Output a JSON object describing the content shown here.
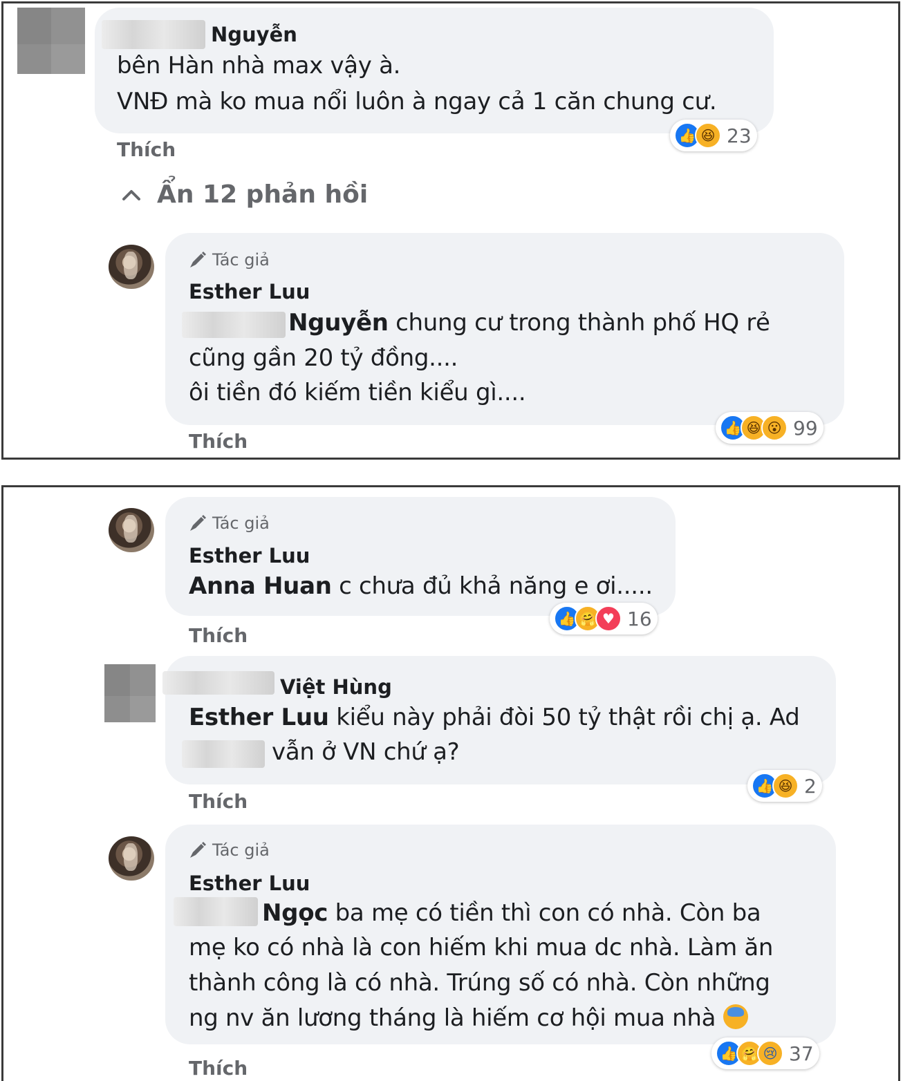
{
  "panel1": {
    "c1": {
      "author": "Nguyễn",
      "lines": [
        "bên Hàn nhà max vậy à.",
        "VNĐ mà ko mua nổi luôn à ngay cả 1 căn chung cư."
      ],
      "like_label": "Thích",
      "reaction_count": "23",
      "reactions": [
        "like-icon",
        "haha-icon"
      ]
    },
    "toggle_label": "Ẩn 12 phản hồi",
    "c2": {
      "tag": "Tác giả",
      "author": "Esther Luu",
      "mention": "Nguyễn",
      "lines": [
        "chung cư trong thành phố HQ rẻ",
        "cũng gần 20 tỷ đồng....",
        "ôi tiền đó kiếm tiền kiểu gì...."
      ],
      "like_label": "Thích",
      "reaction_count": "99",
      "reactions": [
        "like-icon",
        "haha-icon",
        "wow-icon"
      ]
    }
  },
  "panel2": {
    "c3": {
      "tag": "Tác giả",
      "author": "Esther Luu",
      "mention": "Anna Huan",
      "text": "c chưa đủ khả năng e ơi.....",
      "like_label": "Thích",
      "reaction_count": "16",
      "reactions": [
        "like-icon",
        "care-icon",
        "love-icon"
      ]
    },
    "c4": {
      "author": "Việt Hùng",
      "mention": "Esther Luu",
      "line1": "kiểu này phải đòi 50 tỷ thật rồi chị ạ. Ad",
      "line2": "vẫn ở VN chứ ạ?",
      "like_label": "Thích",
      "reaction_count": "2",
      "reactions": [
        "like-icon",
        "haha-icon"
      ]
    },
    "c5": {
      "tag": "Tác giả",
      "author": "Esther Luu",
      "mention": "Ngọc",
      "line1": "ba mẹ có tiền thì con có nhà. Còn ba",
      "line2": "mẹ ko có nhà là con hiếm khi mua dc nhà. Làm ăn",
      "line3": "thành công là có nhà. Trúng số có nhà. Còn những",
      "line4": "ng nv ăn lương tháng là hiếm cơ hội mua nhà",
      "like_label": "Thích",
      "reaction_count": "37",
      "reactions": [
        "like-icon",
        "care-icon",
        "sad-icon"
      ]
    }
  },
  "colors": {
    "bubble": "#f0f2f5",
    "secondary_text": "#65676b",
    "like_blue": "#1877f2",
    "emoji_yellow": "#f7b125",
    "love_red": "#f33e58"
  }
}
